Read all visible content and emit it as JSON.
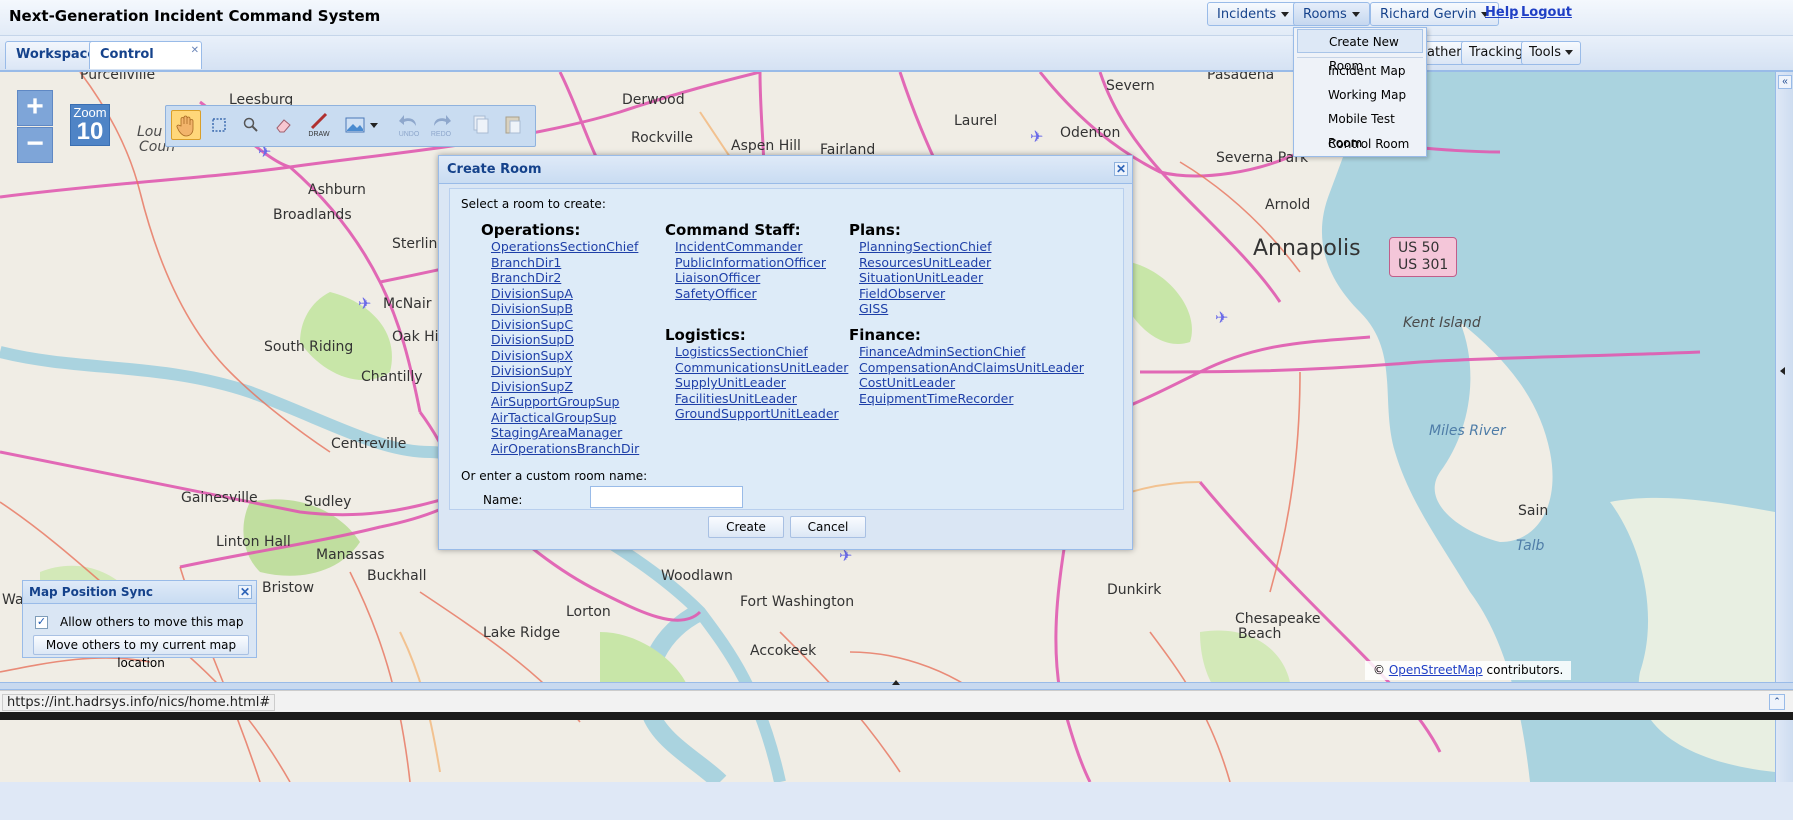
{
  "header": {
    "app_title": "Next-Generation Incident Command System",
    "incidents_label": "Incidents",
    "rooms_label": "Rooms",
    "user_label": "Richard Gervin",
    "help_label": "Help",
    "logout_label": "Logout"
  },
  "tabs": {
    "workspace": "Workspace",
    "control_room": "Control Room",
    "close_glyph": "✕"
  },
  "toolbar_right": {
    "weather_fragment": "ather",
    "tracking": "Tracking",
    "tools": "Tools"
  },
  "rooms_menu": {
    "items": [
      "Create New Room",
      "Incident Map",
      "Working Map",
      "Mobile Test Room",
      "Control Room"
    ]
  },
  "map": {
    "zoom_in": "+",
    "zoom_out": "−",
    "zoom_label": "Zoom",
    "zoom_level": "10",
    "labels": [
      "Purcellville",
      "Leesburg",
      "Lou",
      "Coun",
      "Ashburn",
      "Broadlands",
      "Sterling",
      "McNair",
      "Oak Hil",
      "South Riding",
      "Chantilly",
      "Centreville",
      "Gainesville",
      "Sudley",
      "Linton Hall",
      "Manassas",
      "Bristow",
      "Buckhall",
      "Wa",
      "Lake Ridge",
      "Lorton",
      "Woodlawn",
      "Fort Washington",
      "Accokeek",
      "Derwood",
      "Rockville",
      "Aspen Hill",
      "Fairland",
      "Laurel",
      "Odenton",
      "Severn",
      "Pasadena",
      "Severna Park",
      "Arnold",
      "Annapolis",
      "Dunkirk",
      "Chesapeake",
      "Beach",
      "Sain",
      "Talb"
    ],
    "water_labels": [
      "Kent Island",
      "Miles River"
    ],
    "shield_line1": "US 50",
    "shield_line2": "US 301",
    "attribution_prefix": "©",
    "attribution_link": "OpenStreetMap",
    "attribution_suffix": "contributors.",
    "collapse_glyph": "«",
    "bottom_collapse_glyph": "⌃"
  },
  "draw_toolbar": {
    "draw": "DRAW",
    "undo": "UNDO",
    "redo": "REDO"
  },
  "dialog": {
    "title": "Create Room",
    "prompt": "Select a room to create:",
    "groups": {
      "operations": {
        "title": "Operations:",
        "items": [
          "OperationsSectionChief",
          "BranchDir1",
          "BranchDir2",
          "DivisionSupA",
          "DivisionSupB",
          "DivisionSupC",
          "DivisionSupD",
          "DivisionSupX",
          "DivisionSupY",
          "DivisionSupZ",
          "AirSupportGroupSup",
          "AirTacticalGroupSup",
          "StagingAreaManager",
          "AirOperationsBranchDir"
        ]
      },
      "command_staff": {
        "title": "Command Staff:",
        "items": [
          "IncidentCommander",
          "PublicInformationOfficer",
          "LiaisonOfficer",
          "SafetyOfficer"
        ]
      },
      "logistics": {
        "title": "Logistics:",
        "items": [
          "LogisticsSectionChief",
          "CommunicationsUnitLeader",
          "SupplyUnitLeader",
          "FacilitiesUnitLeader",
          "GroundSupportUnitLeader"
        ]
      },
      "plans": {
        "title": "Plans:",
        "items": [
          "PlanningSectionChief",
          "ResourcesUnitLeader",
          "SituationUnitLeader",
          "FieldObserver",
          "GISS"
        ]
      },
      "finance": {
        "title": "Finance:",
        "items": [
          "FinanceAdminSectionChief",
          "CompensationAndClaimsUnitLeader",
          "CostUnitLeader",
          "EquipmentTimeRecorder"
        ]
      }
    },
    "custom_label": "Or enter a custom room name:",
    "name_label": "Name:",
    "name_value": "",
    "create_label": "Create",
    "cancel_label": "Cancel"
  },
  "sync_panel": {
    "title": "Map Position Sync",
    "checkbox_label": "Allow others to move this map",
    "checked": true,
    "button_label": "Move others to my current map location"
  },
  "status_bar": {
    "url": "https://int.hadrsys.info/nics/home.html#"
  },
  "colors": {
    "accent": "#15428b",
    "link": "#1e3fa8",
    "panel": "#dae6f4",
    "border": "#99bbe8",
    "highway": "#e05ab0",
    "water": "#aad3df",
    "park": "#c8e6a8",
    "active_tool": "#ffd77a"
  }
}
